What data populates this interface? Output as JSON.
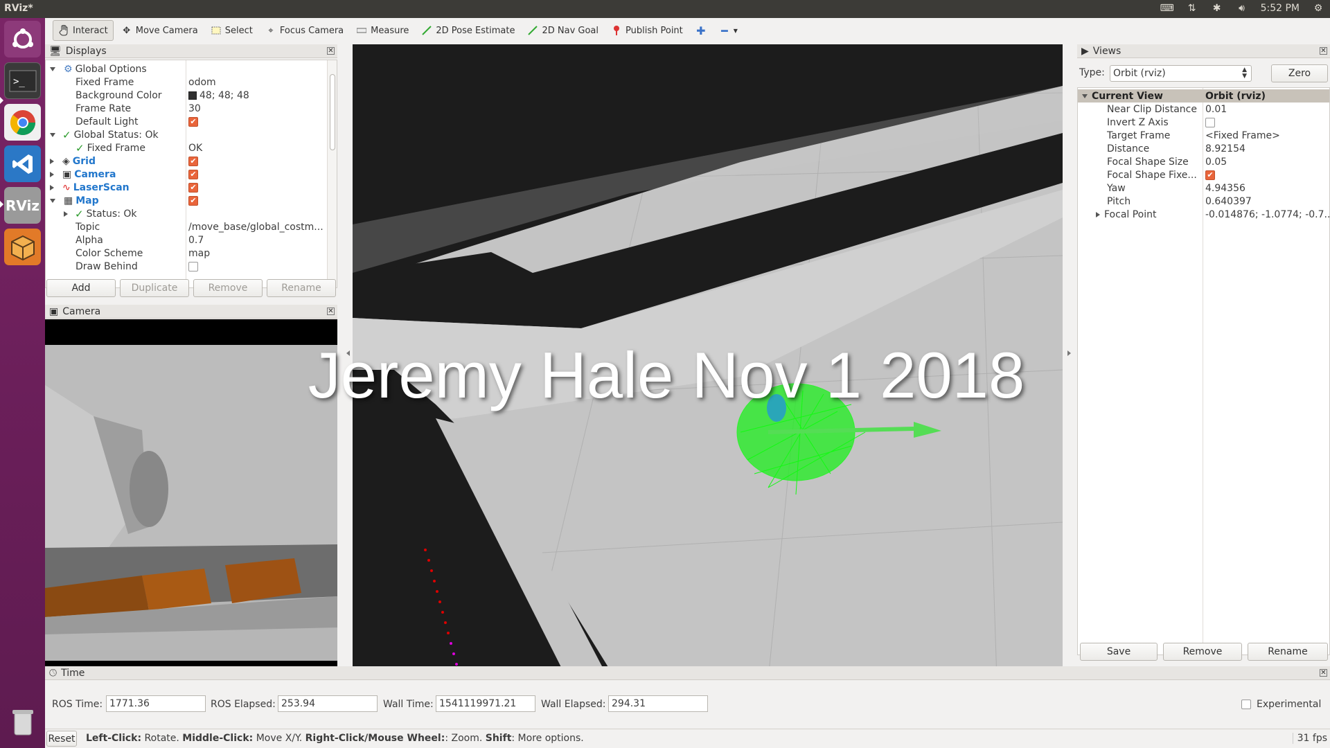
{
  "window": {
    "title": "RViz*"
  },
  "tray": {
    "time": "5:52 PM"
  },
  "toolbar": {
    "tools": [
      {
        "label": "Interact",
        "icon": "hand-icon"
      },
      {
        "label": "Move Camera",
        "icon": "move-camera-icon"
      },
      {
        "label": "Select",
        "icon": "select-icon"
      },
      {
        "label": "Focus Camera",
        "icon": "focus-icon"
      },
      {
        "label": "Measure",
        "icon": "measure-icon"
      },
      {
        "label": "2D Pose Estimate",
        "icon": "pose-arrow-icon"
      },
      {
        "label": "2D Nav Goal",
        "icon": "goal-arrow-icon"
      },
      {
        "label": "Publish Point",
        "icon": "pin-icon"
      }
    ]
  },
  "displays": {
    "title": "Displays",
    "rows": [
      {
        "name": "Global Options",
        "value": ""
      },
      {
        "name": "Fixed Frame",
        "value": "odom"
      },
      {
        "name": "Background Color",
        "value": "48; 48; 48"
      },
      {
        "name": "Frame Rate",
        "value": "30"
      },
      {
        "name": "Default Light",
        "value": ""
      },
      {
        "name": "Global Status: Ok",
        "value": ""
      },
      {
        "name": "Fixed Frame",
        "value": "OK"
      },
      {
        "name": "Grid",
        "value": ""
      },
      {
        "name": "Camera",
        "value": ""
      },
      {
        "name": "LaserScan",
        "value": ""
      },
      {
        "name": "Map",
        "value": ""
      },
      {
        "name": "Status: Ok",
        "value": ""
      },
      {
        "name": "Topic",
        "value": "/move_base/global_costm..."
      },
      {
        "name": "Alpha",
        "value": "0.7"
      },
      {
        "name": "Color Scheme",
        "value": "map"
      },
      {
        "name": "Draw Behind",
        "value": ""
      }
    ],
    "buttons": {
      "add": "Add",
      "duplicate": "Duplicate",
      "remove": "Remove",
      "rename": "Rename"
    }
  },
  "camera_panel": {
    "title": "Camera"
  },
  "views": {
    "title": "Views",
    "type_label": "Type:",
    "type_value": "Orbit (rviz)",
    "zero": "Zero",
    "header": {
      "name": "Current View",
      "value": "Orbit (rviz)"
    },
    "rows": [
      {
        "name": "Near Clip Distance",
        "value": "0.01"
      },
      {
        "name": "Invert Z Axis",
        "value": ""
      },
      {
        "name": "Target Frame",
        "value": "<Fixed Frame>"
      },
      {
        "name": "Distance",
        "value": "8.92154"
      },
      {
        "name": "Focal Shape Size",
        "value": "0.05"
      },
      {
        "name": "Focal Shape Fixe...",
        "value": ""
      },
      {
        "name": "Yaw",
        "value": "4.94356"
      },
      {
        "name": "Pitch",
        "value": "0.640397"
      },
      {
        "name": "Focal Point",
        "value": "-0.014876; -1.0774; -0.7..."
      }
    ],
    "buttons": {
      "save": "Save",
      "remove": "Remove",
      "rename": "Rename"
    }
  },
  "time": {
    "title": "Time",
    "ros_time_label": "ROS Time:",
    "ros_time": "1771.36",
    "ros_elapsed_label": "ROS Elapsed:",
    "ros_elapsed": "253.94",
    "wall_time_label": "Wall Time:",
    "wall_time": "1541119971.21",
    "wall_elapsed_label": "Wall Elapsed:",
    "wall_elapsed": "294.31",
    "experimental": "Experimental"
  },
  "status": {
    "reset": "Reset",
    "k1": "Left-Click:",
    "v1": " Rotate. ",
    "k2": "Middle-Click:",
    "v2": " Move X/Y. ",
    "k3": "Right-Click/Mouse Wheel:",
    "v3": ": Zoom. ",
    "k4": "Shift",
    "v4": ": More options.",
    "fps": "31 fps"
  },
  "overlay": {
    "text": "Jeremy Hale Nov 1 2018"
  }
}
